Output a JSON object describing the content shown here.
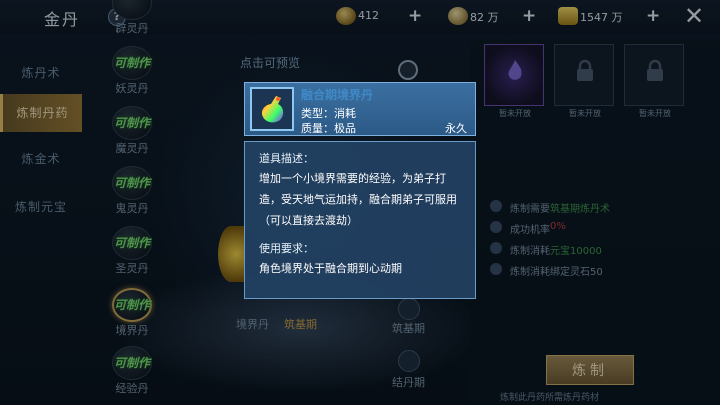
{
  "header": {
    "title": "金丹",
    "help_label": "?",
    "resources": [
      {
        "icon": "spirit-stone-icon",
        "value": "412"
      },
      {
        "icon": "silver-coin-icon",
        "value": "82 万"
      },
      {
        "icon": "gold-ingot-icon",
        "value": "1547 万"
      }
    ],
    "plus_label": "+",
    "close_label": "✕"
  },
  "left_tabs": [
    {
      "label": "炼丹术",
      "active": false
    },
    {
      "label": "炼制丹药",
      "active": true
    },
    {
      "label": "炼金术",
      "active": false
    },
    {
      "label": "炼制元宝",
      "active": false
    }
  ],
  "recipes": [
    {
      "badge": "",
      "name": "辟灵丹"
    },
    {
      "badge": "可制作",
      "name": "妖灵丹"
    },
    {
      "badge": "可制作",
      "name": "魔灵丹"
    },
    {
      "badge": "可制作",
      "name": "鬼灵丹"
    },
    {
      "badge": "可制作",
      "name": "圣灵丹"
    },
    {
      "badge": "可制作",
      "name": "境界丹",
      "selected": true
    },
    {
      "badge": "可制作",
      "name": "经验丹"
    }
  ],
  "center": {
    "preview_hint": "点击可预览",
    "slot_left": "境界丹",
    "slot_right": "筑基期",
    "stages": [
      "筑基期",
      "结丹期"
    ]
  },
  "right_panel": {
    "slots": [
      {
        "label": "暂未开放",
        "unlocked": true
      },
      {
        "label": "暂未开放",
        "unlocked": false
      },
      {
        "label": "暂未开放",
        "unlocked": false
      }
    ],
    "info": [
      {
        "key": "炼制需要",
        "value": "筑基期炼丹术"
      },
      {
        "key": "成功机率",
        "value": "0%"
      },
      {
        "key": "炼制消耗",
        "value": "元宝10000"
      },
      {
        "key": "炼制消耗",
        "value": "绑定灵石50"
      }
    ],
    "craft_label": "炼制",
    "bottom_note": "炼制此丹药所需炼丹药材"
  },
  "tooltip": {
    "name": "融合期境界丹",
    "type": "类型：消耗",
    "quality": "质量：极品",
    "duration": "永久",
    "desc_title": "道具描述：",
    "desc": "增加一个小境界需要的经验，为弟子打造，受天地气运加持，融合期弟子可服用（可以直接去渡劫）",
    "req_title": "使用要求：",
    "req": "角色境界处于融合期到心动期"
  }
}
